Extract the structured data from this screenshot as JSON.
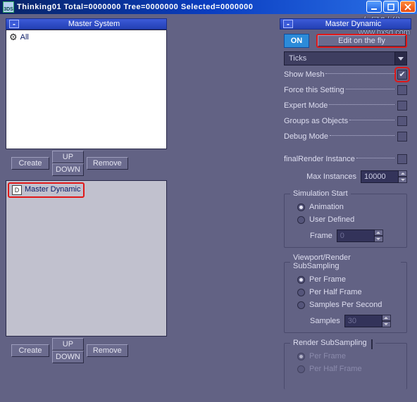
{
  "window": {
    "title": "Thinking01  Total=0000000  Tree=0000000  Selected=0000000"
  },
  "watermark": {
    "brand": "火星时代",
    "url": "www.hxsd.com"
  },
  "left": {
    "system": {
      "title": "Master System",
      "items": [
        {
          "label": "All"
        }
      ],
      "buttons": {
        "create": "Create",
        "up": "UP",
        "down": "DOWN",
        "remove": "Remove"
      }
    },
    "dynamic": {
      "items": [
        {
          "label": "Master Dynamic"
        }
      ],
      "buttons": {
        "create": "Create",
        "up": "UP",
        "down": "DOWN",
        "remove": "Remove"
      }
    }
  },
  "right": {
    "title": "Master Dynamic",
    "on": "ON",
    "editfly": "Edit on the fly",
    "combo": "Ticks",
    "checks": {
      "showmesh": "Show Mesh",
      "force": "Force this Setting",
      "expert": "Expert Mode",
      "groups": "Groups as Objects",
      "debug": "Debug Mode",
      "fri": "finalRender Instance"
    },
    "maxinst": {
      "label": "Max Instances",
      "value": "10000"
    },
    "simstart": {
      "legend": "Simulation Start",
      "anim": "Animation",
      "user": "User Defined",
      "frame_label": "Frame",
      "frame_value": "0"
    },
    "vpss": {
      "legend": "Viewport/Render SubSampling",
      "perframe": "Per Frame",
      "perhalf": "Per Half Frame",
      "sps": "Samples Per Second",
      "samples_label": "Samples",
      "samples_value": "30"
    },
    "rss": {
      "legend": "Render SubSampling",
      "perframe": "Per Frame",
      "perhalf": "Per Half Frame"
    }
  }
}
